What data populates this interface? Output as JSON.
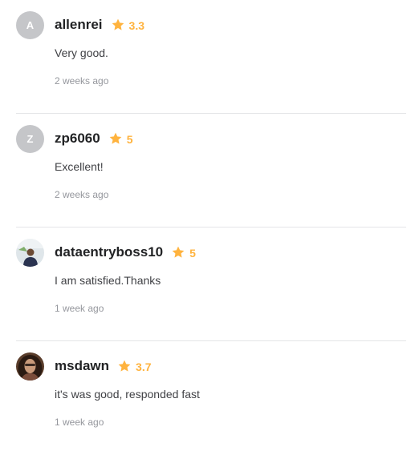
{
  "reviews": [
    {
      "username": "allenrei",
      "avatar_letter": "A",
      "rating": "3.3",
      "text": "Very good.",
      "time": "2 weeks ago",
      "star_icon": "star-icon",
      "star_color": "#ffb33e"
    },
    {
      "username": "zp6060",
      "avatar_letter": "Z",
      "rating": "5",
      "text": "Excellent!",
      "time": "2 weeks ago",
      "star_icon": "star-icon",
      "star_color": "#ffb33e"
    },
    {
      "username": "dataentryboss10",
      "avatar_letter": "",
      "rating": "5",
      "text": "I am satisfied.Thanks",
      "time": "1 week ago",
      "star_icon": "star-icon",
      "star_color": "#ffb33e"
    },
    {
      "username": "msdawn",
      "avatar_letter": "",
      "rating": "3.7",
      "text": "it's was good, responded fast",
      "time": "1 week ago",
      "star_icon": "star-icon",
      "star_color": "#ffb33e"
    }
  ]
}
